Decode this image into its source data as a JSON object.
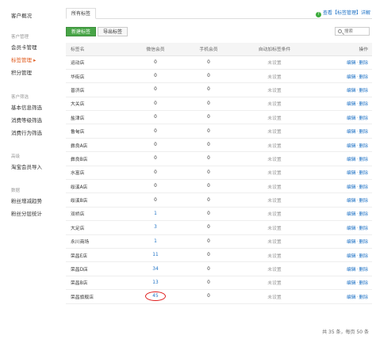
{
  "sidebar": {
    "top_item": "客户概况",
    "groups": [
      {
        "title": "客户管理",
        "items": [
          {
            "label": "会员卡管理",
            "active": false
          },
          {
            "label": "标签管理 ▸",
            "active": true
          },
          {
            "label": "积分管理",
            "active": false
          }
        ]
      },
      {
        "title": "客户筛选",
        "items": [
          {
            "label": "基本信息筛选",
            "active": false
          },
          {
            "label": "消费等级筛选",
            "active": false
          },
          {
            "label": "消费行为筛选",
            "active": false
          }
        ]
      },
      {
        "title": "高级",
        "items": [
          {
            "label": "淘宝会员导入",
            "active": false
          }
        ]
      },
      {
        "title": "数据",
        "items": [
          {
            "label": "粉丝增减趋势",
            "active": false
          },
          {
            "label": "粉丝分层统计",
            "active": false
          }
        ]
      }
    ]
  },
  "tabs": {
    "all_tags": "所有标签"
  },
  "help": {
    "icon": "?",
    "text": "查看【标签管理】详解"
  },
  "toolbar": {
    "new_tag": "新建标签",
    "export_tag": "导出标签"
  },
  "search": {
    "placeholder": "搜索"
  },
  "table": {
    "headers": {
      "name": "标签名",
      "wechat": "微信会员",
      "phone": "手机会员",
      "auto": "自动加标签条件",
      "op": "操作"
    },
    "edit_label": "编辑",
    "delete_label": "删除",
    "rows": [
      {
        "name": "运动店",
        "wechat": "0",
        "phone": "0",
        "auto": "未设置"
      },
      {
        "name": "华街店",
        "wechat": "0",
        "phone": "0",
        "auto": "未设置"
      },
      {
        "name": "普济店",
        "wechat": "0",
        "phone": "0",
        "auto": "未设置"
      },
      {
        "name": "大关店",
        "wechat": "0",
        "phone": "0",
        "auto": "未设置"
      },
      {
        "name": "盐津店",
        "wechat": "0",
        "phone": "0",
        "auto": "未设置"
      },
      {
        "name": "鲁甸店",
        "wechat": "0",
        "phone": "0",
        "auto": "未设置"
      },
      {
        "name": "彝良A店",
        "wechat": "0",
        "phone": "0",
        "auto": "未设置"
      },
      {
        "name": "彝良B店",
        "wechat": "0",
        "phone": "0",
        "auto": "未设置"
      },
      {
        "name": "水富店",
        "wechat": "0",
        "phone": "0",
        "auto": "未设置"
      },
      {
        "name": "绥溪A店",
        "wechat": "0",
        "phone": "0",
        "auto": "未设置"
      },
      {
        "name": "绥溪B店",
        "wechat": "0",
        "phone": "0",
        "auto": "未设置"
      },
      {
        "name": "双桥店",
        "wechat": "1",
        "phone": "0",
        "auto": "未设置"
      },
      {
        "name": "大足店",
        "wechat": "3",
        "phone": "0",
        "auto": "未设置"
      },
      {
        "name": "永川商场",
        "wechat": "1",
        "phone": "0",
        "auto": "未设置"
      },
      {
        "name": "荣昌E店",
        "wechat": "11",
        "phone": "0",
        "auto": "未设置"
      },
      {
        "name": "荣昌D店",
        "wechat": "34",
        "phone": "0",
        "auto": "未设置"
      },
      {
        "name": "荣昌B店",
        "wechat": "13",
        "phone": "0",
        "auto": "未设置"
      },
      {
        "name": "荣昌旗舰店",
        "wechat": "45",
        "phone": "0",
        "auto": "未设置",
        "circled": true
      }
    ]
  },
  "footer": {
    "summary": "共 35 条，每页 50 条"
  },
  "colors": {
    "accent_green": "#48a547",
    "link_blue": "#1a6fc4",
    "active_orange": "#e05a1c",
    "circle_red": "#e02020"
  }
}
